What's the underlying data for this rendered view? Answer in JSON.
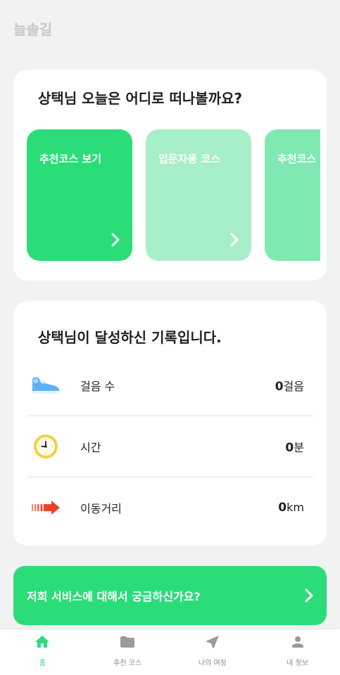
{
  "app": {
    "title": "늘솔길"
  },
  "explore": {
    "user_name": "상택",
    "title_suffix": "님 오늘은 어디로 떠나볼까요?",
    "courses": [
      {
        "label": "추천코스 보기",
        "color": "#2bdd79",
        "icon": "chevron-right-icon"
      },
      {
        "label": "입문자용 코스",
        "color": "#a7efc8",
        "icon": "chevron-right-icon"
      },
      {
        "label": "추천코스",
        "color": "#7fe9b1",
        "icon": "chevron-right-icon"
      }
    ]
  },
  "stats": {
    "user_name": "상택",
    "title_suffix": "님이 달성하신 기록입니다.",
    "rows": [
      {
        "icon": "sneaker-icon",
        "label": "걸음 수",
        "value": "0",
        "unit": "걸음"
      },
      {
        "icon": "clock-icon",
        "label": "시간",
        "value": "0",
        "unit": "분"
      },
      {
        "icon": "arrow-right-icon",
        "label": "이동거리",
        "value": "0",
        "unit": "km"
      }
    ]
  },
  "banner": {
    "text": "저희 서비스에 대해서 궁금하신가요?",
    "color": "#2bdd79",
    "icon": "chevron-right-icon"
  },
  "bottom_nav": {
    "items": [
      {
        "label": "홈",
        "icon": "home-icon",
        "active": true
      },
      {
        "label": "추천 코스",
        "icon": "folder-icon",
        "active": false
      },
      {
        "label": "나의 여정",
        "icon": "navigation-icon",
        "active": false
      },
      {
        "label": "내 정보",
        "icon": "user-icon",
        "active": false
      }
    ]
  },
  "colors": {
    "background": "#f1f2f2",
    "accent": "#2bdd79",
    "header_text": "#c5c7c8",
    "inactive_icon": "#9a9a9a"
  }
}
